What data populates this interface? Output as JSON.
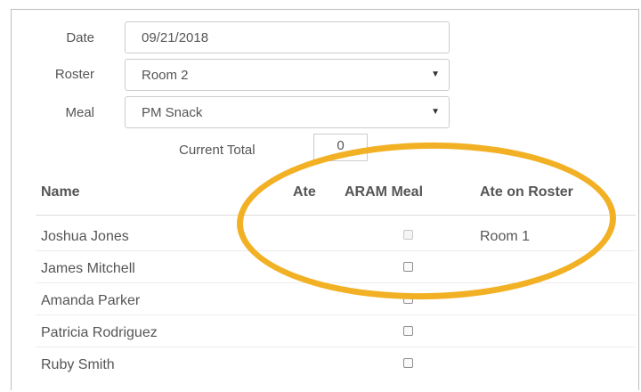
{
  "form": {
    "date_label": "Date",
    "date_value": "09/21/2018",
    "roster_label": "Roster",
    "roster_value": "Room 2",
    "meal_label": "Meal",
    "meal_value": "PM Snack",
    "caret_icon": "caret-down-icon",
    "current_total_label": "Current Total",
    "current_total_value": "0"
  },
  "table": {
    "headers": {
      "name": "Name",
      "ate": "Ate",
      "aram_meal": "ARAM Meal",
      "ate_on_roster": "Ate on Roster"
    },
    "rows": [
      {
        "name": "Joshua Jones",
        "aram_disabled": true,
        "ate_on_roster": "Room 1"
      },
      {
        "name": "James Mitchell",
        "aram_disabled": false,
        "ate_on_roster": ""
      },
      {
        "name": "Amanda Parker",
        "aram_disabled": false,
        "ate_on_roster": ""
      },
      {
        "name": "Patricia Rodriguez",
        "aram_disabled": false,
        "ate_on_roster": ""
      },
      {
        "name": "Ruby Smith",
        "aram_disabled": false,
        "ate_on_roster": ""
      }
    ]
  },
  "annotation": {
    "color": "#f2b124"
  }
}
